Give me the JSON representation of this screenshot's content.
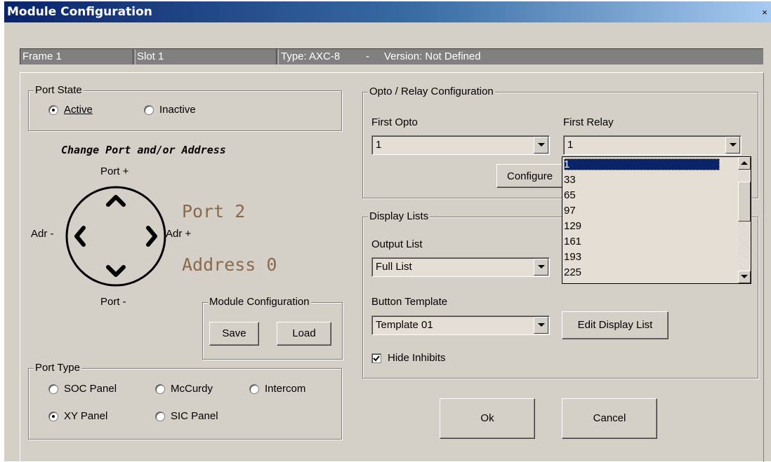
{
  "window": {
    "title": "Module Configuration",
    "close_glyph": "×"
  },
  "status": {
    "frame": "Frame 1",
    "slot": "Slot 1",
    "type": "Type: AXC-8",
    "sep": "-",
    "version": "Version: Not Defined"
  },
  "port_state": {
    "label": "Port State",
    "options": [
      {
        "label": "Active",
        "checked": true
      },
      {
        "label": "Inactive",
        "checked": false
      }
    ]
  },
  "navigator": {
    "heading": "Change Port and/or Address",
    "port_plus": "Port +",
    "port_minus": "Port -",
    "adr_minus": "Adr -",
    "adr_plus": "Adr +",
    "port_value": "Port 2",
    "address_value": "Address 0"
  },
  "module_config": {
    "label": "Module Configuration",
    "save": "Save",
    "load": "Load"
  },
  "port_type": {
    "label": "Port Type",
    "options": [
      {
        "label": "SOC Panel",
        "checked": false
      },
      {
        "label": "McCurdy",
        "checked": false
      },
      {
        "label": "Intercom",
        "checked": false
      },
      {
        "label": "XY Panel",
        "checked": true
      },
      {
        "label": "SIC Panel",
        "checked": false
      }
    ]
  },
  "opto_relay": {
    "label": "Opto / Relay Configuration",
    "first_opto_label": "First Opto",
    "first_opto_value": "1",
    "first_relay_label": "First Relay",
    "first_relay_value": "1",
    "configure_button": "Configure"
  },
  "relay_dropdown": {
    "items": [
      "1",
      "33",
      "65",
      "97",
      "129",
      "161",
      "193",
      "225"
    ],
    "selected_index": 0
  },
  "display_lists": {
    "label": "Display Lists",
    "output_list_label": "Output List",
    "output_list_value": "Full List",
    "button_template_label": "Button Template",
    "button_template_value": "Template 01",
    "edit_button": "Edit Display List",
    "hide_inhibits_label": "Hide Inhibits",
    "hide_inhibits_checked": true
  },
  "footer": {
    "ok": "Ok",
    "cancel": "Cancel"
  },
  "colors": {
    "title_gradient_start": "#0a246a",
    "dialog_bg": "#d4d0c8",
    "field_bg": "#e5ded5",
    "accent_text": "#8b6a4a",
    "selection": "#0a246a"
  }
}
